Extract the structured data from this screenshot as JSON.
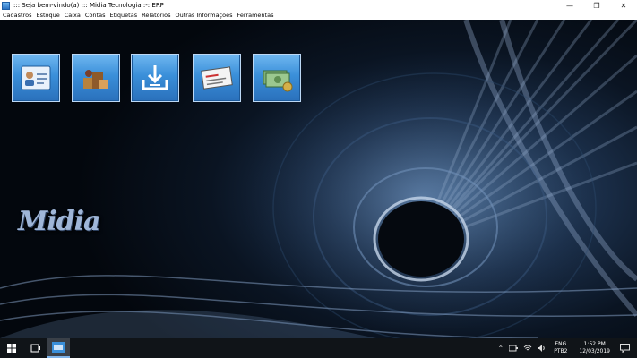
{
  "window": {
    "title": "::: Seja bem-vindo(a) ::: Midia Tecnologia :-: ERP",
    "minimize_glyph": "—",
    "restore_glyph": "❐",
    "close_glyph": "✕"
  },
  "menu": {
    "items": [
      {
        "label": "Cadastros"
      },
      {
        "label": "Estoque"
      },
      {
        "label": "Caixa"
      },
      {
        "label": "Contas"
      },
      {
        "label": "Etiquetas"
      },
      {
        "label": "Relatórios"
      },
      {
        "label": "Outras Informações"
      },
      {
        "label": "Ferramentas"
      }
    ]
  },
  "toolbar": {
    "buttons": [
      {
        "icon": "user-card-icon"
      },
      {
        "icon": "products-icon"
      },
      {
        "icon": "download-tray-icon"
      },
      {
        "icon": "receipt-icon"
      },
      {
        "icon": "money-icon"
      }
    ]
  },
  "logo": {
    "text": "Midia"
  },
  "taskbar": {
    "lang": "ENG",
    "layout": "PTB2",
    "time": "1:52 PM",
    "date": "12/03/2019"
  },
  "colors": {
    "tool_button": "#3a8fd9",
    "taskbar": "#101418",
    "background_dark": "#03070d",
    "background_light": "#3a5a80"
  }
}
